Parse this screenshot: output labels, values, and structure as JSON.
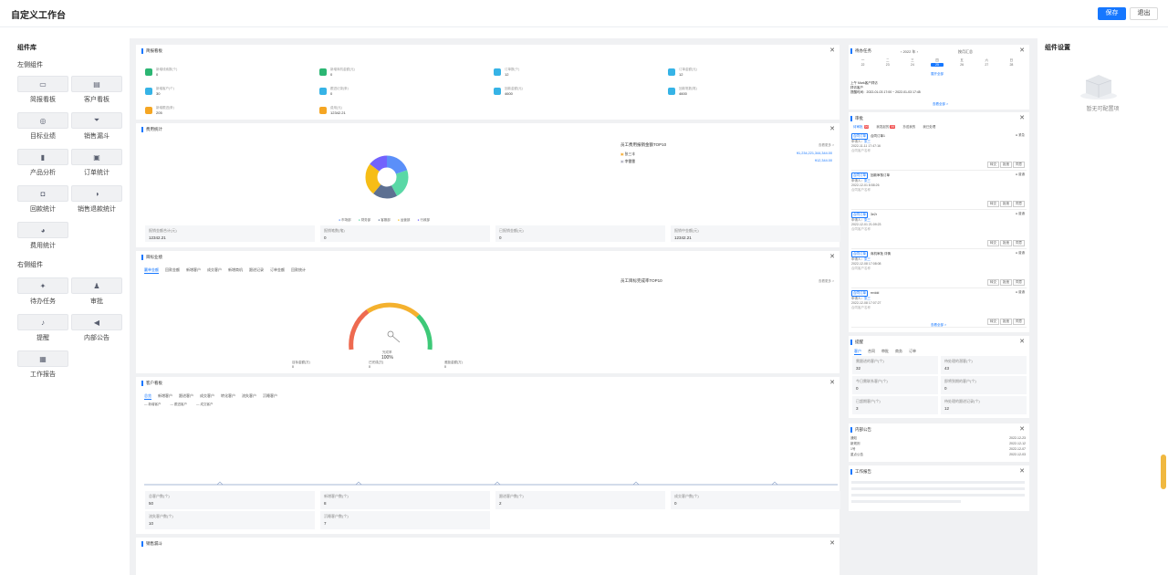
{
  "app": {
    "title": "自定义工作台",
    "save": "保存",
    "exit": "退出"
  },
  "library": {
    "heading": "组件库",
    "left_section": "左侧组件",
    "right_section": "右侧组件",
    "left_items": [
      {
        "label": "简报看板",
        "icon": "monitor-icon"
      },
      {
        "label": "客户看板",
        "icon": "building-icon"
      },
      {
        "label": "目标业绩",
        "icon": "target-icon"
      },
      {
        "label": "销售漏斗",
        "icon": "funnel-icon"
      },
      {
        "label": "产品分析",
        "icon": "bar-chart-icon"
      },
      {
        "label": "订单统计",
        "icon": "clipboard-icon"
      },
      {
        "label": "回款统计",
        "icon": "wallet-icon"
      },
      {
        "label": "销售退款统计",
        "icon": "refund-icon"
      },
      {
        "label": "费用统计",
        "icon": "pie-icon"
      }
    ],
    "right_items": [
      {
        "label": "待办任务",
        "icon": "pin-icon"
      },
      {
        "label": "审批",
        "icon": "stamp-icon"
      },
      {
        "label": "提醒",
        "icon": "bell-icon"
      },
      {
        "label": "内部公告",
        "icon": "speaker-icon"
      },
      {
        "label": "工作报告",
        "icon": "document-icon"
      }
    ]
  },
  "settings": {
    "heading": "组件设置",
    "empty": "暂无可配置项"
  },
  "brief": {
    "title": "简报看板",
    "items": [
      {
        "name": "新增线索数(个)",
        "value": "0",
        "color": "#2bb673"
      },
      {
        "name": "新增商机金额(元)",
        "value": "0",
        "color": "#2bb673"
      },
      {
        "name": "订单数(个)",
        "value": "12",
        "color": "#36b3e6"
      },
      {
        "name": "订单金额(元)",
        "value": "12",
        "color": "#36b3e6"
      },
      {
        "name": "新增客户(个)",
        "value": "30",
        "color": "#36b3e6"
      },
      {
        "name": "跟进记录(条)",
        "value": "0",
        "color": "#36b3e6"
      },
      {
        "name": "回款金额(元)",
        "value": "4600",
        "color": "#36b3e6"
      },
      {
        "name": "回款笔数(笔)",
        "value": "4600",
        "color": "#36b3e6"
      },
      {
        "name": "新增跟进(条)",
        "value": "205",
        "color": "#f5a623"
      },
      {
        "name": "费用(元)",
        "value": "12342.21",
        "color": "#f5a623"
      }
    ]
  },
  "expense": {
    "title": "费用统计",
    "rank_title": "员工费用报销金额TOP10",
    "view_more": "查看更多 >",
    "rank": [
      {
        "name": "张三丰",
        "amount": "¥1,234,221,344,344.00"
      },
      {
        "name": "李雷雷",
        "amount": "¥12,344.00"
      }
    ],
    "legend": [
      "市场部",
      "财务部",
      "客服部",
      "运营部",
      "行政部"
    ],
    "stats": [
      {
        "label": "报销金额合计(元)",
        "value": "12342.21"
      },
      {
        "label": "报销笔数(笔)",
        "value": "0"
      },
      {
        "label": "已报销金额(元)",
        "value": "0"
      },
      {
        "label": "报销中金额(元)",
        "value": "12342.21"
      }
    ]
  },
  "target": {
    "title": "目标业绩",
    "tabs": [
      "赢单金额",
      "回款金额",
      "新增客户",
      "成交客户",
      "新增商机",
      "跟进记录",
      "订单金额",
      "回款统计"
    ],
    "rank_title": "员工目标完成率TOP10",
    "view_more": "查看更多 >",
    "gauge_label": "完成率",
    "gauge_value": "100%",
    "stats": [
      {
        "label": "目标金额(万)",
        "value": "0"
      },
      {
        "label": "已完成(万)",
        "value": "0"
      },
      {
        "label": "差距金额(万)",
        "value": "0"
      }
    ]
  },
  "customer": {
    "title": "客户看板",
    "tabs": [
      "总览",
      "新增客户",
      "跟进客户",
      "成交客户",
      "转化客户",
      "流失客户",
      "沉睡客户"
    ],
    "legend": [
      "新增客户",
      "跟进客户",
      "成交客户"
    ],
    "stats": [
      {
        "label": "总客户数(个)",
        "value": "50"
      },
      {
        "label": "新增客户数(个)",
        "value": "8"
      },
      {
        "label": "跟进客户数(个)",
        "value": "2"
      },
      {
        "label": "成交客户数(个)",
        "value": "0"
      },
      {
        "label": "流失客户数(个)",
        "value": "10"
      },
      {
        "label": "沉睡客户数(个)",
        "value": "7"
      }
    ]
  },
  "funnel": {
    "title": "销售漏斗"
  },
  "todo": {
    "title": "待办任务",
    "year": "2022 年",
    "month_switch": "按月汇总",
    "weekdays": [
      "一",
      "二",
      "三",
      "四",
      "五",
      "六",
      "日"
    ],
    "days": [
      "22",
      "23",
      "24",
      "25",
      "26",
      "27",
      "28"
    ],
    "expand": "展开全部",
    "event_title": "上午 Mark客户拜访",
    "event_sub": "拜访客户",
    "event_time": "提醒时间：2022-01-03 17:00 ~ 2022-01-03 17:45",
    "view_all": "查看全部 >"
  },
  "approval": {
    "title": "审批",
    "tabs": [
      "待审批",
      "我发起的",
      "抄送我的",
      "我已处理"
    ],
    "badge": "99",
    "items": [
      {
        "type": "合同订单",
        "name": "合同订单1",
        "applicant_label": "申请人：",
        "applicant": "张三",
        "time": "2022-11-11 17:47:16",
        "note": "合同客户名称",
        "flag": "● 紧急"
      },
      {
        "type": "合同订单",
        "name": "回款审核订单",
        "applicant_label": "申请人：",
        "applicant": "张三",
        "time": "2022-12-01 8:58:26",
        "note": "合同客户名称",
        "flag": "● 普通"
      },
      {
        "type": "合同订单",
        "name": "3e2r",
        "applicant_label": "申请人：",
        "applicant": "张三",
        "time": "2022-12-01 21:09:23",
        "note": "合同客户名称",
        "flag": "● 普通"
      },
      {
        "type": "合同订单",
        "name": "商机审批 详情",
        "applicant_label": "申请人：",
        "applicant": "张三",
        "time": "2022-12-08 17:08:08",
        "note": "合同客户名称",
        "flag": "● 普通"
      },
      {
        "type": "合同订单",
        "name": "rrrddd",
        "applicant_label": "申请人：",
        "applicant": "张三",
        "time": "2022-12-08 17:07:27",
        "note": "合同客户名称",
        "flag": "● 普通"
      }
    ],
    "btn_transfer": "转交",
    "btn_reject": "拒绝",
    "btn_agree": "同意",
    "view_all": "查看全部 >"
  },
  "remind": {
    "title": "提醒",
    "tabs": [
      "客户",
      "合同",
      "审批",
      "商务",
      "订单"
    ],
    "stats": [
      {
        "label": "需跟进的客户(个)",
        "value": "32"
      },
      {
        "label": "待处理的潜客(个)",
        "value": "43"
      },
      {
        "label": "今日需联系客户(个)",
        "value": "0"
      },
      {
        "label": "即将到期的客户(个)",
        "value": "0"
      },
      {
        "label": "已超期客户(个)",
        "value": "3"
      },
      {
        "label": "待处理的跟进记录(个)",
        "value": "12"
      }
    ]
  },
  "notice": {
    "title": "内部公告",
    "items": [
      {
        "name": "通知",
        "date": "2022-12-23"
      },
      {
        "name": "新规则",
        "date": "2022-12-12"
      },
      {
        "name": "1号",
        "date": "2022-12-07"
      },
      {
        "name": "重点公告",
        "date": "2022-12-03"
      }
    ]
  },
  "report": {
    "title": "工作报告"
  }
}
